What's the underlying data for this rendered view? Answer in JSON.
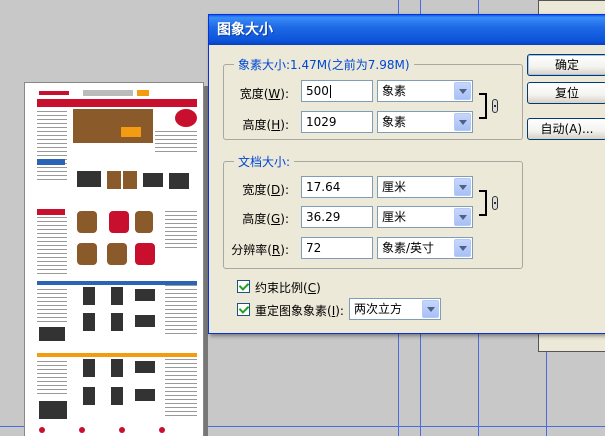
{
  "dialog": {
    "title": "图象大小",
    "pixel_group": {
      "title": "象素大小:1.47M(之前为7.98M)",
      "width_label": "宽度(",
      "width_key": "W",
      "width_suffix": "):",
      "width_value": "500",
      "width_unit": "象素",
      "height_label": "高度(",
      "height_key": "H",
      "height_suffix": "):",
      "height_value": "1029",
      "height_unit": "象素"
    },
    "doc_group": {
      "title": "文档大小:",
      "width_label": "宽度(",
      "width_key": "D",
      "width_suffix": "):",
      "width_value": "17.64",
      "width_unit": "厘米",
      "height_label": "高度(",
      "height_key": "G",
      "height_suffix": "):",
      "height_value": "36.29",
      "height_unit": "厘米",
      "res_label": "分辨率(",
      "res_key": "R",
      "res_suffix": "):",
      "res_value": "72",
      "res_unit": "象素/英寸"
    },
    "constrain": {
      "label": "约束比例(",
      "key": "C",
      "suffix": ")"
    },
    "resample": {
      "label": "重定图象象素(",
      "key": "I",
      "suffix": "):",
      "method": "两次立方"
    },
    "buttons": {
      "ok": "确定",
      "reset": "复位",
      "auto": "自动(A)..."
    }
  }
}
